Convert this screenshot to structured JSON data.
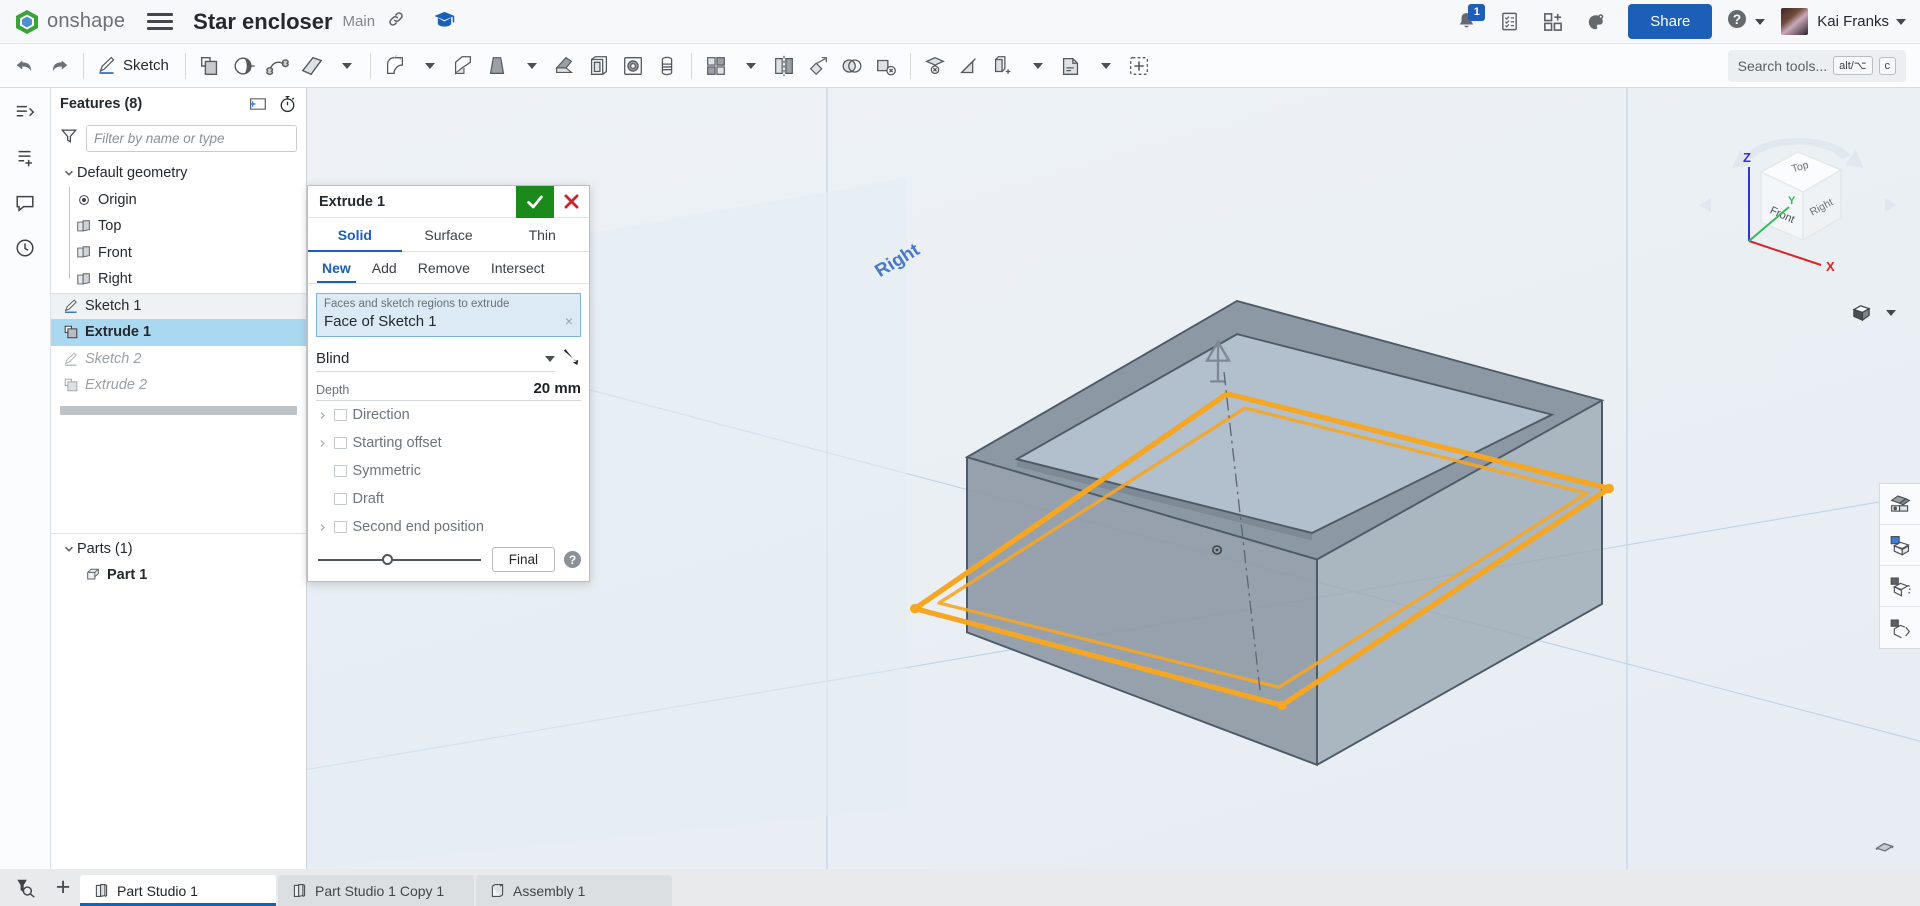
{
  "header": {
    "brand": "onshape",
    "document_title": "Star encloser",
    "branch": "Main",
    "notification_count": "1",
    "share_label": "Share",
    "user_name": "Kai Franks"
  },
  "toolbar": {
    "sketch_label": "Sketch",
    "search_placeholder": "Search tools...",
    "shortcut_alt": "alt/⌥",
    "shortcut_key": "c"
  },
  "features_panel": {
    "title": "Features (8)",
    "filter_placeholder": "Filter by name or type",
    "tree": [
      {
        "label": "Default geometry",
        "icon": "chevron-down-icon",
        "state": "group"
      },
      {
        "label": "Origin",
        "icon": "origin-icon",
        "state": "child"
      },
      {
        "label": "Top",
        "icon": "plane-icon",
        "state": "child"
      },
      {
        "label": "Front",
        "icon": "plane-icon",
        "state": "child"
      },
      {
        "label": "Right",
        "icon": "plane-icon",
        "state": "child"
      },
      {
        "label": "Sketch 1",
        "icon": "sketch-icon",
        "state": "highlight"
      },
      {
        "label": "Extrude 1",
        "icon": "extrude-icon",
        "state": "selected"
      },
      {
        "label": "Sketch 2",
        "icon": "sketch-icon",
        "state": "rolled-back"
      },
      {
        "label": "Extrude 2",
        "icon": "extrude-icon",
        "state": "rolled-back"
      }
    ],
    "parts_title": "Parts (1)",
    "parts": [
      {
        "label": "Part 1",
        "icon": "part-icon"
      }
    ]
  },
  "extrude_dialog": {
    "title": "Extrude 1",
    "tabs": [
      {
        "label": "Solid",
        "active": true
      },
      {
        "label": "Surface",
        "active": false
      },
      {
        "label": "Thin",
        "active": false
      }
    ],
    "operations": [
      {
        "label": "New",
        "active": true
      },
      {
        "label": "Add",
        "active": false
      },
      {
        "label": "Remove",
        "active": false
      },
      {
        "label": "Intersect",
        "active": false
      }
    ],
    "selection_caption": "Faces and sketch regions to extrude",
    "selection_value": "Face of Sketch 1",
    "clear_glyph": "×",
    "end_type": "Blind",
    "depth_label": "Depth",
    "depth_value": "20 mm",
    "options": [
      {
        "label": "Direction",
        "expandable": true,
        "checked": false
      },
      {
        "label": "Starting offset",
        "expandable": true,
        "checked": false
      },
      {
        "label": "Symmetric",
        "expandable": false,
        "checked": false
      },
      {
        "label": "Draft",
        "expandable": false,
        "checked": false
      },
      {
        "label": "Second end position",
        "expandable": true,
        "checked": false
      }
    ],
    "final_label": "Final",
    "help_glyph": "?",
    "accent_blue": "#1b5fb8",
    "confirm_green": "#1a8a1a",
    "cancel_red": "#cc2229"
  },
  "viewport": {
    "plane_label_right": "Right",
    "view_cube": {
      "top": "Top",
      "front": "Front",
      "right": "Right",
      "axis_x": "X",
      "axis_y": "Y",
      "axis_z": "Z"
    },
    "sketch_highlight_color": "#f5a623",
    "body_color": "#8f9ba6"
  },
  "document_tabs": [
    {
      "label": "Part Studio 1",
      "icon": "part-studio-icon",
      "active": true
    },
    {
      "label": "Part Studio 1 Copy 1",
      "icon": "part-studio-icon",
      "active": false
    },
    {
      "label": "Assembly 1",
      "icon": "assembly-icon",
      "active": false
    }
  ]
}
